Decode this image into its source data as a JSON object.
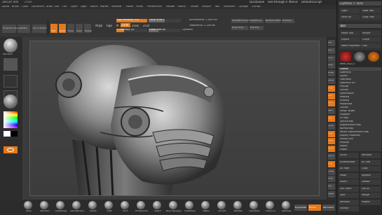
{
  "window": {
    "title": "ZBrush 4R6",
    "doc_name": "ZTool"
  },
  "menu": [
    "Alpha",
    "Brush",
    "Color",
    "Document",
    "Draw",
    "Edit",
    "File",
    "Layer",
    "Light",
    "Macro",
    "Marker",
    "Material",
    "Movie",
    "Picker",
    "Preferences",
    "Render",
    "Stencil",
    "Stroke",
    "Texture",
    "Tool",
    "Transform",
    "Zplugin",
    "Zscript"
  ],
  "title_bar": {
    "quicksave": "QuickSave",
    "see_through": "See-through 0",
    "menus": "Menus",
    "default_script": "DefaultZScript"
  },
  "top_shelf": {
    "projection_master": "Projection Master",
    "lightbox": "LightBox",
    "quick_sketch": "Quick Sketch",
    "edit": "Edit",
    "draw": "Draw",
    "move": "Move",
    "scale": "Scale",
    "rotate": "Rotate",
    "mrgb": "Mrgb",
    "rgb": "Rgb",
    "m": "M",
    "zadd": "Zadd",
    "zsub": "Zsub",
    "zcut": "Zcut",
    "focal_shift": "Focal Shift 0",
    "draw_size": "Draw Size 64",
    "dynamic": "Dynamic",
    "rgb_intensity": "Rgb Intensity 100",
    "z_intensity": "Z Intensity 25",
    "active_points": "ActivePoints: 1.994 Mil",
    "total_points": "TotalPoints: 2.246 Mil",
    "spotlight": "Spotlight Projection",
    "lazy_mouse": "LazyMouse",
    "backface_mask": "Backface Mask",
    "sel_lasso": "SelLasso",
    "draw_tools": "Draw Tools",
    "edit_poly": "Edit Poly"
  },
  "tray": {
    "tabs": [
      "Tool",
      "Light",
      "Load Tool",
      "Save As",
      "Copy Tool",
      "Paste Tool",
      "Import",
      "Export",
      "Clone",
      "Make PolyMesh3D",
      "GoZ",
      "All",
      "Visible",
      "R"
    ],
    "lightbox_tools": "Lightbox > Tools",
    "current_tool": "PM3D_Head_2",
    "subtools": [
      "Subtool",
      "Geometry",
      "Layers",
      "FiberMesh",
      "Geometry HD",
      "Preview",
      "Surface",
      "Deformation",
      "Masking",
      "Visibility",
      "Polygroups",
      "Contact",
      "Morph Target",
      "Polypaint",
      "UV Map",
      "Texture Map",
      "Displacement Map",
      "Normal Map",
      "Vector Displacement Map",
      "Display Properties",
      "Unified Skin",
      "Initialize",
      "Import",
      "Export"
    ],
    "sections": [
      "Scroll",
      "Rename",
      "AutoReorder",
      "All Low",
      "All High",
      "Copy",
      "Paste",
      "Append",
      "Insert",
      "Delete",
      "Del Other",
      "Del All",
      "Split",
      "Merge",
      "Remesh",
      "Project",
      "Extract"
    ]
  },
  "left_shelf": {
    "brush": "Standard",
    "stroke": "Dots",
    "alpha": "Off",
    "texture": "Off",
    "material": "MatCap Gray",
    "gradient": "Gradient",
    "switch_color": "SwitchColor",
    "alternate": "Alternate"
  },
  "right_shelf": [
    "BPR",
    "SPix 3",
    "Scroll",
    "Zoom",
    "Actual",
    "AAHalf",
    "Persp",
    "Floor",
    "Local",
    "LSym",
    "Xyz",
    "Frame",
    "Move",
    "Scale",
    "Rotate",
    "Line Fill",
    "PolyF",
    "Transp",
    "Ghost",
    "Solo",
    "Xpose"
  ],
  "bottom_shelf": {
    "brushes": [
      "Move",
      "Standard",
      "ClayBuildup",
      "DamStandard",
      "hPolish",
      "Inflat",
      "Pinch",
      "TrimDynamic",
      "Slash3",
      "Move Topological",
      "SnakeHook",
      "Flatten",
      "Smooth",
      "MaskPen",
      "SelectRect",
      "ClipCurve",
      "ZModeler"
    ],
    "right_buttons": [
      "Dynamesh",
      "Divide",
      "Del Lower"
    ]
  }
}
